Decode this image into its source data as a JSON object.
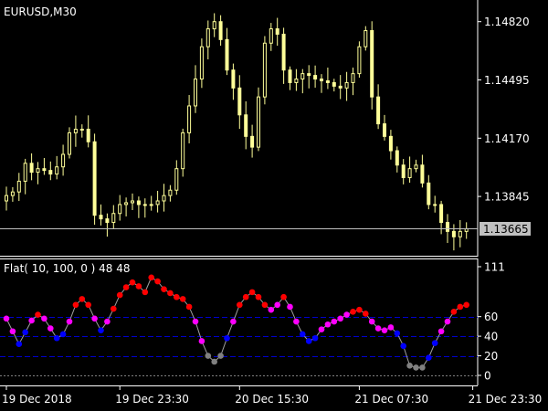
{
  "header": {
    "symbol_label": "EURUSD,M30",
    "indicator_label": "Flat( 10, 100, 0 ) 48 48"
  },
  "colors": {
    "background": "#000000",
    "foreground": "#FFFFFF",
    "candle": "#FFFF99",
    "price_line": "#C0C0C0",
    "price_badge": "#C0C0C0",
    "level_line": "#0000CC",
    "zero_line": "#808080",
    "flat_red": "#FF0000",
    "flat_magenta": "#FF00FF",
    "flat_blue": "#0000FF",
    "flat_gray": "#808080",
    "flat_connector": "#A0A0A0"
  },
  "chart_data": [
    {
      "type": "candlestick",
      "title": "EURUSD,M30",
      "ylim": [
        1.1355,
        1.149
      ],
      "y_ticks": [
        "1.14820",
        "1.14495",
        "1.14170",
        "1.13845"
      ],
      "current_price_label": "1.13665",
      "current_price": 1.13665,
      "grid": false,
      "closes": [
        1.1385,
        1.1387,
        1.1393,
        1.1403,
        1.1398,
        1.14,
        1.1399,
        1.1397,
        1.1401,
        1.1408,
        1.142,
        1.1422,
        1.1422,
        1.1415,
        1.1374,
        1.1372,
        1.137,
        1.1375,
        1.138,
        1.1381,
        1.1382,
        1.138,
        1.138,
        1.138,
        1.1382,
        1.1385,
        1.1388,
        1.14,
        1.142,
        1.1435,
        1.145,
        1.1468,
        1.1478,
        1.1482,
        1.1472,
        1.1455,
        1.1445,
        1.143,
        1.1418,
        1.1412,
        1.144,
        1.147,
        1.1478,
        1.1475,
        1.1455,
        1.1448,
        1.145,
        1.1453,
        1.1452,
        1.145,
        1.1449,
        1.1448,
        1.1446,
        1.1445,
        1.1448,
        1.1453,
        1.1468,
        1.1477,
        1.144,
        1.1425,
        1.1418,
        1.141,
        1.1402,
        1.1395,
        1.14,
        1.1402,
        1.1392,
        1.138,
        1.138,
        1.137,
        1.1365,
        1.1362,
        1.1365,
        1.13665
      ]
    },
    {
      "type": "scatter",
      "title": "Flat( 10, 100, 0 ) 48 48",
      "ylim": [
        0,
        111
      ],
      "y_ticks": [
        "111",
        "60",
        "40",
        "20",
        "0"
      ],
      "levels": [
        60,
        40,
        20
      ],
      "zero_level": 0,
      "values": [
        58,
        45,
        32,
        44,
        56,
        62,
        58,
        48,
        38,
        42,
        55,
        72,
        78,
        72,
        58,
        46,
        55,
        68,
        82,
        90,
        95,
        91,
        85,
        100,
        96,
        88,
        84,
        80,
        78,
        70,
        55,
        35,
        20,
        14,
        20,
        38,
        55,
        72,
        80,
        85,
        80,
        72,
        67,
        72,
        80,
        70,
        55,
        42,
        35,
        38,
        47,
        52,
        55,
        58,
        62,
        65,
        67,
        63,
        55,
        48,
        46,
        49,
        43,
        30,
        10,
        8,
        8,
        18,
        33,
        45,
        55,
        65,
        70,
        72
      ],
      "colors": [
        "m",
        "m",
        "b",
        "b",
        "m",
        "r",
        "m",
        "m",
        "b",
        "b",
        "m",
        "r",
        "r",
        "r",
        "m",
        "b",
        "m",
        "r",
        "r",
        "r",
        "r",
        "r",
        "r",
        "r",
        "r",
        "r",
        "r",
        "r",
        "r",
        "r",
        "m",
        "m",
        "g",
        "g",
        "g",
        "b",
        "m",
        "r",
        "r",
        "r",
        "r",
        "r",
        "m",
        "m",
        "r",
        "m",
        "m",
        "b",
        "b",
        "b",
        "m",
        "m",
        "m",
        "m",
        "m",
        "r",
        "r",
        "r",
        "m",
        "m",
        "m",
        "m",
        "b",
        "b",
        "g",
        "g",
        "g",
        "b",
        "b",
        "m",
        "m",
        "r",
        "r",
        "r"
      ]
    }
  ],
  "x_axis": {
    "tick_labels": [
      "19 Dec 2018",
      "19 Dec 23:30",
      "20 Dec 15:30",
      "21 Dec 07:30",
      "21 Dec 23:30"
    ],
    "tick_bars": [
      0,
      18,
      37,
      56,
      74
    ]
  }
}
